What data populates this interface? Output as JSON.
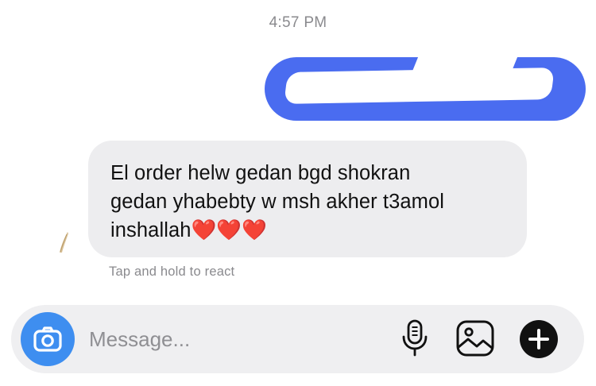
{
  "header": {
    "timestamp": "4:57 PM"
  },
  "messages": {
    "outgoing": {
      "text": "",
      "redacted": true,
      "bubble_color": "#4a6cf0"
    },
    "incoming": {
      "text": "El order helw gedan bgd shokran\ngedan yhabebty w msh akher t3amol\ninshallah❤️❤️❤️",
      "bubble_color": "#ededef"
    },
    "react_hint": "Tap and hold to react"
  },
  "composer": {
    "placeholder": "Message...",
    "value": "",
    "camera_icon": "camera-icon",
    "mic_icon": "microphone-icon",
    "gallery_icon": "gallery-icon",
    "plus_icon": "plus-icon",
    "camera_color": "#3e8ef0"
  }
}
